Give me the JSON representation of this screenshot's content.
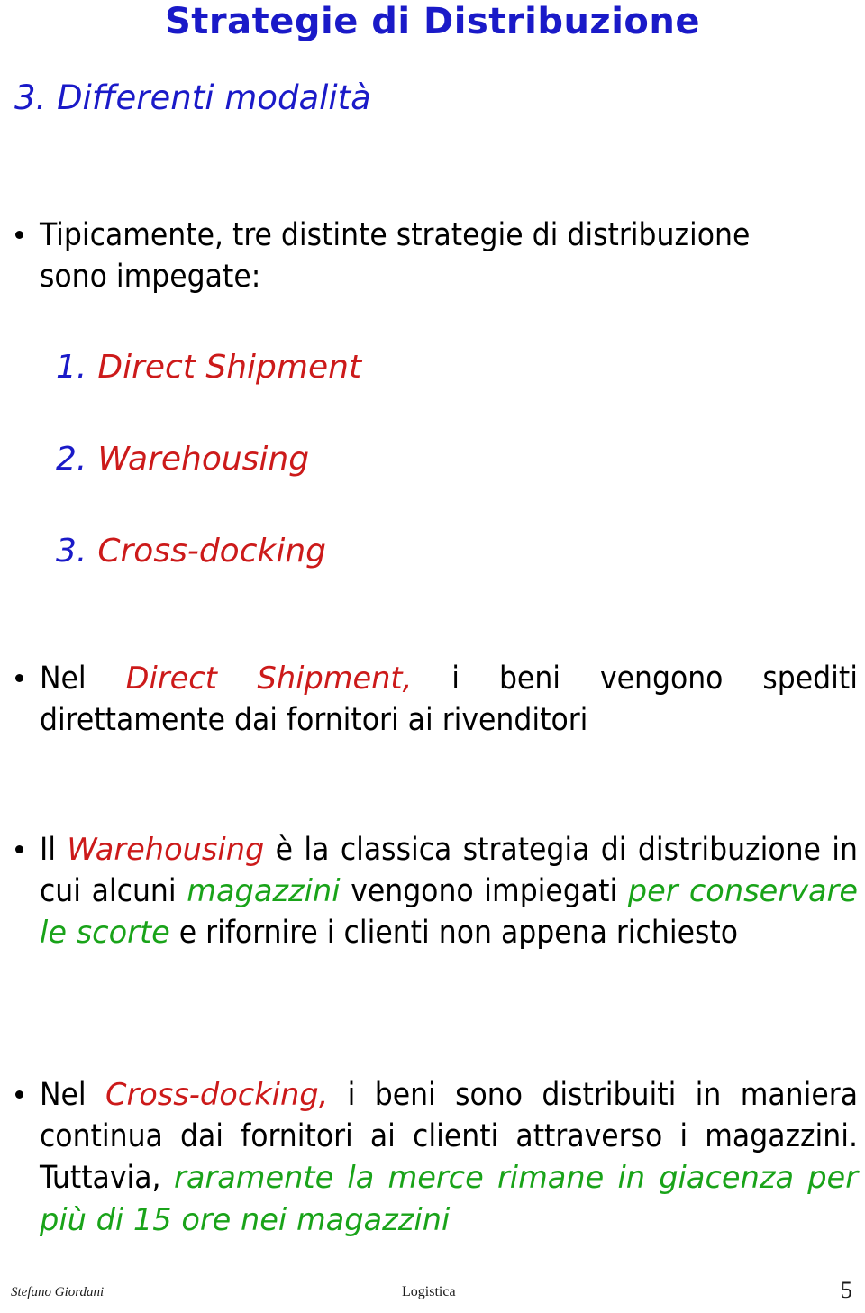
{
  "slide": {
    "title": "Strategie di Distribuzione",
    "section_heading": "3. Differenti modalità",
    "colors": {
      "title_blue": "#1a1ac8",
      "accent_red": "#cc1a1a",
      "accent_green": "#19a319",
      "body_black": "#000000",
      "background": "#ffffff"
    }
  },
  "intro": {
    "line1": "Tipicamente, tre distinte strategie di distribuzione",
    "line2": "sono impegate:"
  },
  "strategies": [
    {
      "number": "1.",
      "label": "Direct Shipment"
    },
    {
      "number": "2.",
      "label": "Warehousing"
    },
    {
      "number": "3.",
      "label": "Cross-docking"
    }
  ],
  "paragraphs": {
    "direct_shipment": {
      "p1": "Nel ",
      "em1": "Direct Shipment,",
      "p2": " i beni vengono spediti direttamente dai fornitori ai rivenditori"
    },
    "warehousing": {
      "p1": "Il ",
      "em1": "Warehousing",
      "p2": " è la classica strategia di distribuzione in cui alcuni ",
      "em2": "magazzini",
      "p3": " vengono impiegati ",
      "em3": "per conservare le scorte",
      "p4": " e rifornire i clienti non appena richiesto"
    },
    "cross_docking": {
      "p1": "Nel ",
      "em1": "Cross-docking,",
      "p2": " i beni sono distribuiti in maniera continua dai fornitori ai clienti attraverso i magazzini. Tuttavia, ",
      "em2": "raramente la merce rimane in giacenza per più di 15 ore nei magazzini"
    }
  },
  "footer": {
    "author": "Stefano Giordani",
    "course": "Logistica",
    "page": "5"
  }
}
